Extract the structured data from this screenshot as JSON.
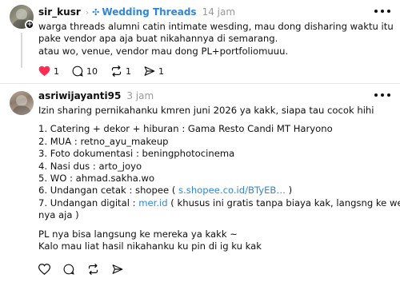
{
  "post1": {
    "username": "sir_kusr",
    "topic": "Wedding Threads",
    "time": "14 jam",
    "lines": [
      "warga threads alumni catin intimate wesding, mau dong disharing waktu itu",
      "pake vendor apa aja buat nikahannya di semarang.",
      "atau wo, venue, vendor mau dong PL+portfoliomuuu."
    ],
    "likes": "1",
    "replies": "10",
    "reposts": "1",
    "shares": "1"
  },
  "post2": {
    "username": "asriwijayanti95",
    "time": "3 jam",
    "intro": "Izin sharing pernikahanku kmren juni 2026 ya kakk, siapa tau cocok hihi",
    "items": [
      "1. Catering + dekor + hiburan : Gama Resto Candi MT Haryono",
      "2. MUA : retno_ayu_makeup",
      "3. Foto dokumentasi : beningphotocinema",
      "4. Nasi dus : arto_joyo",
      "5. WO : ahmad.sakha.wo"
    ],
    "item6_prefix": "6. Undangan cetak : shopee ( ",
    "item6_link": "s.shopee.co.id/BTyEB…",
    "item6_suffix": " )",
    "item7_prefix": "7. Undangan digital : ",
    "item7_link": "mer.id",
    "item7_suffix": " ( khusus ini gratis tanpa biaya kak, langsng ke web",
    "item7_cont": "nya aja )",
    "outro": [
      "PL nya bisa langsung ke mereka ya kakk ~",
      "Kalo mau liat hasil nikahanku ku pin di ig ku kak"
    ]
  },
  "colors": {
    "accent": "#2f86d8",
    "like": "#ff2d55",
    "muted": "#999999"
  },
  "icons": [
    "plus-icon",
    "topic-icon",
    "more-icon",
    "heart-icon",
    "comment-icon",
    "repost-icon",
    "share-icon"
  ]
}
